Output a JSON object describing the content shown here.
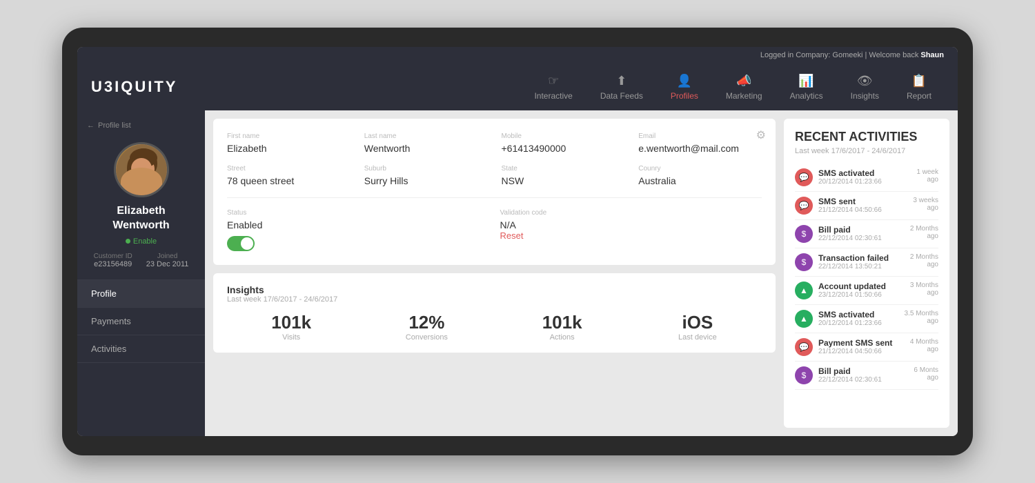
{
  "topbar": {
    "text": "Logged in Company: Gomeeki | Welcome back ",
    "username": "Shaun"
  },
  "logo": {
    "text": "U3IQUITY"
  },
  "nav": {
    "items": [
      {
        "id": "interactive",
        "label": "Interactive",
        "icon": "☞"
      },
      {
        "id": "data-feeds",
        "label": "Data Feeds",
        "icon": "↑"
      },
      {
        "id": "profiles",
        "label": "Profiles",
        "icon": "👤"
      },
      {
        "id": "marketing",
        "label": "Marketing",
        "icon": "📣"
      },
      {
        "id": "analytics",
        "label": "Analytics",
        "icon": "📊"
      },
      {
        "id": "insights",
        "label": "Insights",
        "icon": "👁"
      },
      {
        "id": "report",
        "label": "Report",
        "icon": "📋"
      }
    ],
    "active": "profiles"
  },
  "sidebar": {
    "back_label": "Profile list",
    "profile_name": "Elizabeth\nWentworth",
    "profile_name_line1": "Elizabeth",
    "profile_name_line2": "Wentworth",
    "enable_label": "Enable",
    "customer_id_label": "Customer ID",
    "customer_id": "e23156489",
    "joined_label": "Joined",
    "joined": "23 Dec 2011",
    "nav_items": [
      {
        "id": "profile",
        "label": "Profile",
        "active": true
      },
      {
        "id": "payments",
        "label": "Payments"
      },
      {
        "id": "activities",
        "label": "Activities"
      }
    ]
  },
  "profile_form": {
    "fields": [
      {
        "label": "First name",
        "value": "Elizabeth"
      },
      {
        "label": "Last name",
        "value": "Wentworth"
      },
      {
        "label": "Mobile",
        "value": "+61413490000"
      },
      {
        "label": "Email",
        "value": "e.wentworth@mail.com"
      },
      {
        "label": "Street",
        "value": "78 queen street"
      },
      {
        "label": "Suburb",
        "value": "Surry Hills"
      },
      {
        "label": "State",
        "value": "NSW"
      },
      {
        "label": "Counry",
        "value": "Australia"
      }
    ],
    "status_label": "Status",
    "status_value": "Enabled",
    "validation_label": "Validation code",
    "validation_value": "N/A",
    "reset_label": "Reset"
  },
  "insights": {
    "title": "Insights",
    "date_range": "Last week 17/6/2017 - 24/6/2017",
    "metrics": [
      {
        "number": "101k",
        "label": "Visits"
      },
      {
        "number": "12%",
        "label": "Conversions"
      },
      {
        "number": "101k",
        "label": "Actions"
      },
      {
        "number": "iOS",
        "label": "Last device"
      }
    ]
  },
  "recent_activities": {
    "title": "RECENT ACTIVITIES",
    "date_range": "Last week 17/6/2017 - 24/6/2017",
    "items": [
      {
        "type": "sms",
        "color": "red",
        "title": "SMS activated",
        "date": "20/12/2014 01:23:66",
        "time_ago": "1 week\nago"
      },
      {
        "type": "sms",
        "color": "red",
        "title": "SMS sent",
        "date": "21/12/2014 04:50:66",
        "time_ago": "3 weeks\nago"
      },
      {
        "type": "bill",
        "color": "purple",
        "title": "Bill paid",
        "date": "22/12/2014 02:30:61",
        "time_ago": "2 Months\nago"
      },
      {
        "type": "transaction",
        "color": "purple",
        "title": "Transaction failed",
        "date": "22/12/2014 13:50:21",
        "time_ago": "2 Months\nago"
      },
      {
        "type": "account",
        "color": "green",
        "title": "Account updated",
        "date": "23/12/2014 01:50:66",
        "time_ago": "3 Months\nago"
      },
      {
        "type": "sms",
        "color": "green",
        "title": "SMS activated",
        "date": "20/12/2014 01:23:66",
        "time_ago": "3.5 Months\nago"
      },
      {
        "type": "payment",
        "color": "red",
        "title": "Payment SMS sent",
        "date": "21/12/2014 04:50:66",
        "time_ago": "4 Months\nago"
      },
      {
        "type": "bill",
        "color": "purple",
        "title": "Bill paid",
        "date": "22/12/2014 02:30:61",
        "time_ago": "6 Monts\nago"
      }
    ]
  }
}
